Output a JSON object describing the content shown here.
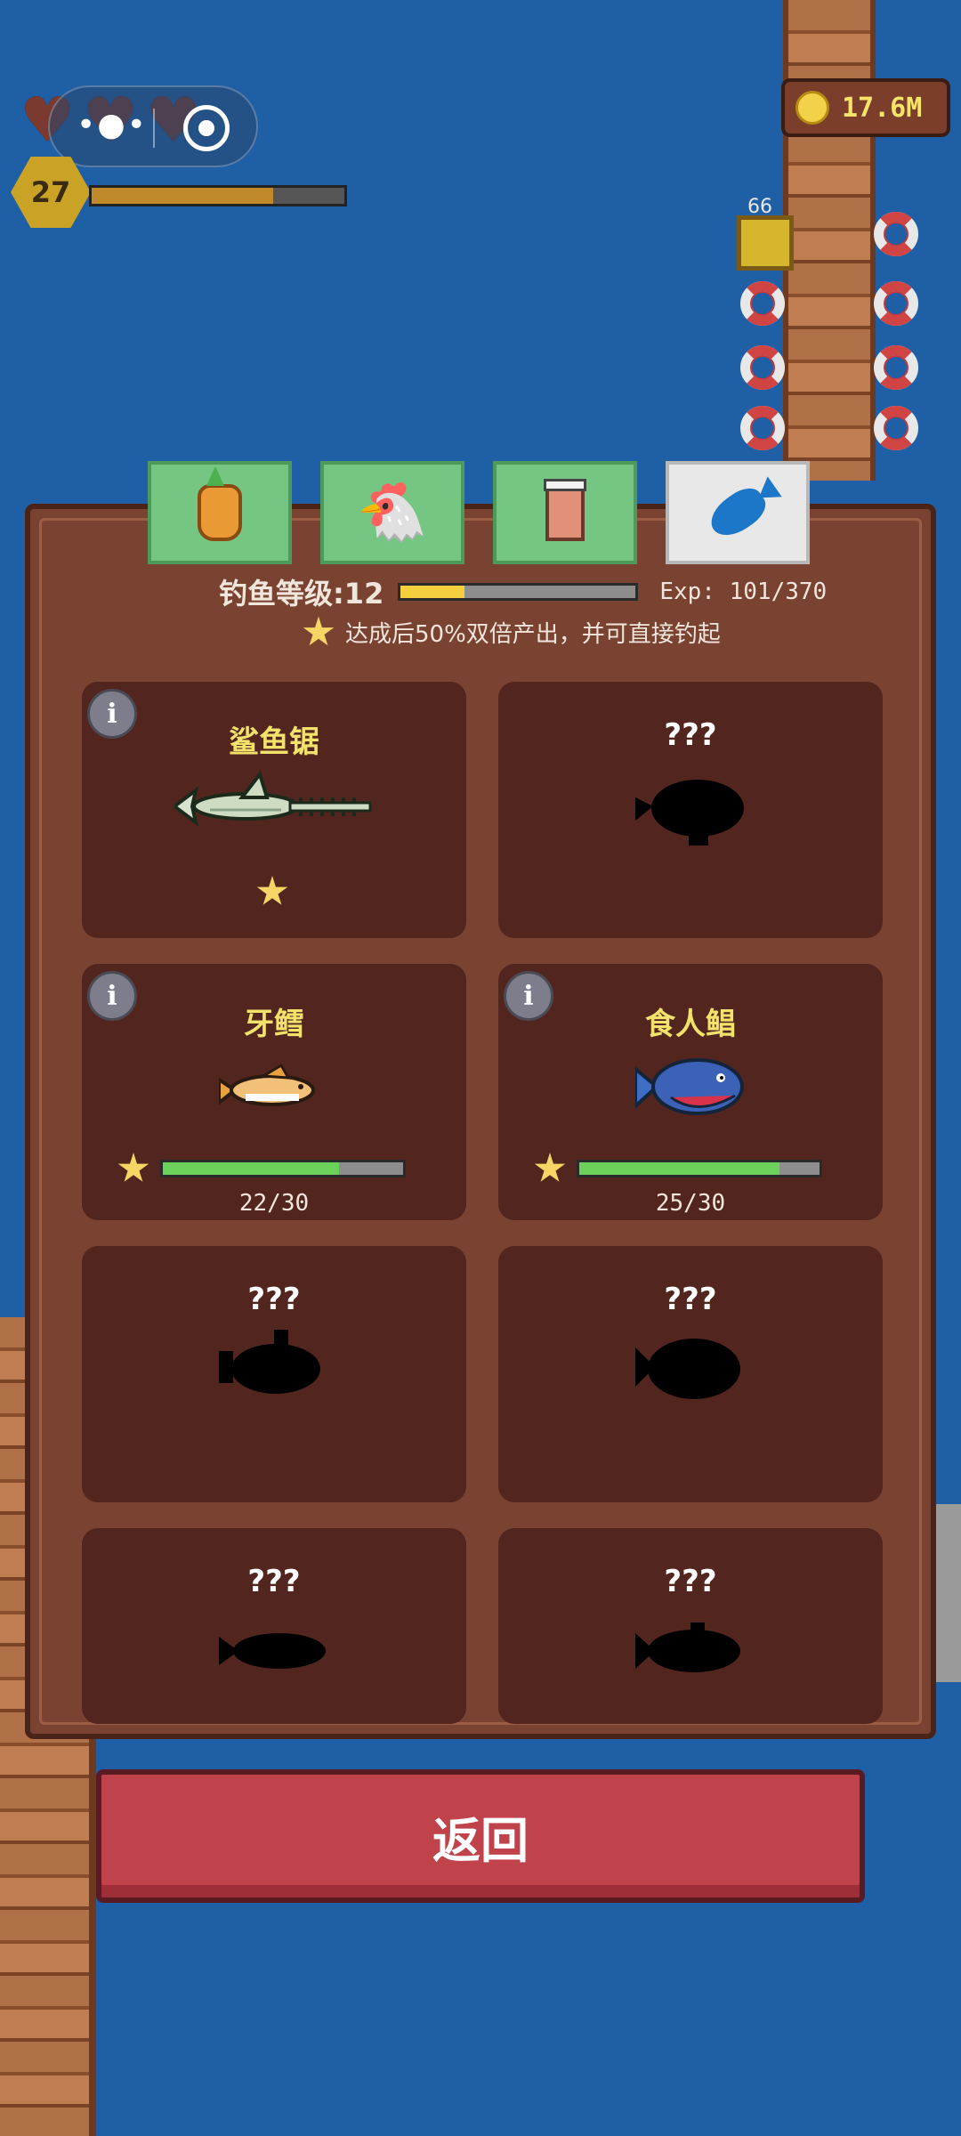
{
  "hud": {
    "player_level": "27",
    "xp_progress": 0.72,
    "coins": "17.6M",
    "crate_count": "66",
    "hearts": [
      "heart-icon",
      "heart-icon",
      "heart-icon"
    ]
  },
  "tabs": [
    {
      "name": "tab-farming",
      "icon": "pineapple-icon",
      "active": false
    },
    {
      "name": "tab-livestock",
      "icon": "chicken-icon",
      "active": false
    },
    {
      "name": "tab-cooking",
      "icon": "jar-icon",
      "active": false
    },
    {
      "name": "tab-fishing",
      "icon": "fish-icon",
      "active": true
    }
  ],
  "fishing": {
    "level_label": "钓鱼等级:12",
    "level_progress": 0.27,
    "exp_label": "Exp: 101/370",
    "tip": "达成后50%双倍产出，并可直接钓起"
  },
  "cards": [
    {
      "name": "鲨鱼锯",
      "known": true,
      "starred": true
    },
    {
      "name": "???",
      "known": false
    },
    {
      "name": "牙鳕",
      "known": true,
      "progress": "22/30",
      "progress_value": 0.733
    },
    {
      "name": "食人鲳",
      "known": true,
      "progress": "25/30",
      "progress_value": 0.833
    },
    {
      "name": "???",
      "known": false
    },
    {
      "name": "???",
      "known": false
    },
    {
      "name": "???",
      "known": false
    },
    {
      "name": "???",
      "known": false
    }
  ],
  "back_button": "返回",
  "colors": {
    "water": "#1f5fa5",
    "panel": "#7a4331",
    "card": "#52261f",
    "fish_name": "#f2e26b",
    "button": "#c0434c",
    "tab_green": "#74c682"
  }
}
